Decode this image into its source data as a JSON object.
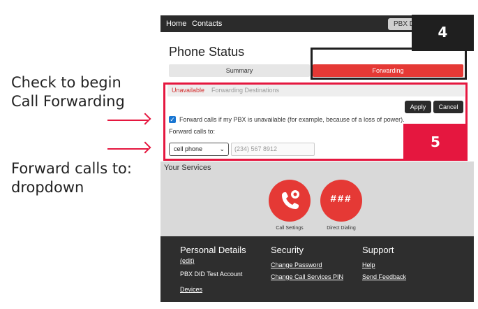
{
  "annotations": {
    "check_note": [
      "Check to begin",
      "Call Forwarding"
    ],
    "forward_note": [
      "Forward calls to:",
      "dropdown"
    ]
  },
  "callouts": {
    "badge_4": "4",
    "badge_5": "5"
  },
  "topbar": {
    "home": "Home",
    "contacts": "Contacts",
    "pbx_button": "PBX D"
  },
  "page": {
    "title": "Phone Status"
  },
  "tabs": {
    "summary": "Summary",
    "forwarding": "Forwarding"
  },
  "forwarding": {
    "subtab_unavailable": "Unavailable",
    "subtab_destinations": "Forwarding Destinations",
    "apply": "Apply",
    "cancel": "Cancel",
    "checkbox_label": "Forward calls if my PBX is unavailable (for example, because of a loss of power).",
    "checkbox_checked": true,
    "forward_to_label": "Forward calls to:",
    "select_value": "cell phone",
    "phone_placeholder": "(234) 567 8912"
  },
  "services": {
    "title": "Your Services",
    "items": [
      {
        "label": "Call Settings",
        "icon": "phone-gear-icon"
      },
      {
        "label": "Direct Dialing",
        "icon": "hash-icon",
        "glyph": "###"
      }
    ]
  },
  "footer": {
    "personal_title": "Personal Details",
    "personal_edit": "(edit)",
    "account_name": "PBX DID Test Account",
    "devices": "Devices",
    "security_title": "Security",
    "change_password": "Change Password",
    "change_pin": "Change Call Services PIN",
    "support_title": "Support",
    "help": "Help",
    "send_feedback": "Send Feedback"
  },
  "colors": {
    "accent_red": "#e53935",
    "highlight_red": "#e5173f",
    "dark": "#2b2b2b"
  }
}
